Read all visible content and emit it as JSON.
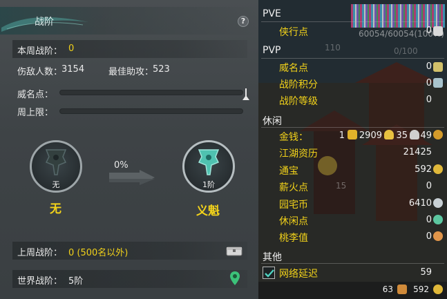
{
  "left": {
    "title": "战阶",
    "help": "?",
    "week_rank_label": "本周战阶：",
    "week_rank_value": "0",
    "kills_label": "伤敌人数：",
    "kills_value": "3154",
    "assist_label": "最佳助攻：",
    "assist_value": "523",
    "fame_label": "威名点：",
    "weekly_cap_label": "周上限：",
    "fame_progress": 0,
    "weekly_cap_progress": 0,
    "current_emblem_caption": "无",
    "current_rank_name": "无",
    "progress_percent": "0%",
    "next_emblem_caption": "1阶",
    "next_rank_name": "义魁",
    "last_week_label": "上周战阶：",
    "last_week_value": "0 (500名以外)",
    "world_label": "世界战阶：",
    "world_value": "5阶"
  },
  "right": {
    "top_clip": "",
    "hp_text": "60054/60054(100%)",
    "bg_110": "110",
    "bg_0100": "0/100",
    "bg_15": "15",
    "pve": {
      "header": "PVE",
      "items": [
        {
          "label": "侠行点",
          "value": "0"
        }
      ]
    },
    "pvp": {
      "header": "PVP",
      "items": [
        {
          "label": "威名点",
          "value": "0"
        },
        {
          "label": "战阶积分",
          "value": "0"
        },
        {
          "label": "战阶等级",
          "value": "0"
        }
      ]
    },
    "leisure": {
      "header": "休闲",
      "money_label": "金钱：",
      "money_gold": "1",
      "money_silver": "2909",
      "money_copper": "35",
      "money_other": "49",
      "items": [
        {
          "label": "江湖资历",
          "value": "21425"
        },
        {
          "label": "通宝",
          "value": "592"
        },
        {
          "label": "薪火点",
          "value": "0"
        },
        {
          "label": "园宅币",
          "value": "6410"
        },
        {
          "label": "休闲点",
          "value": "0"
        },
        {
          "label": "桃李值",
          "value": "0"
        }
      ]
    },
    "other": {
      "header": "其他",
      "latency_label": "网络延迟",
      "latency_value": "59"
    },
    "bottom": {
      "count_a": "63",
      "count_b": "592"
    }
  },
  "colors": {
    "accent_yellow": "#f2d21a",
    "panel_bg": "#44494c",
    "right_bg": "#2d3a3e"
  }
}
